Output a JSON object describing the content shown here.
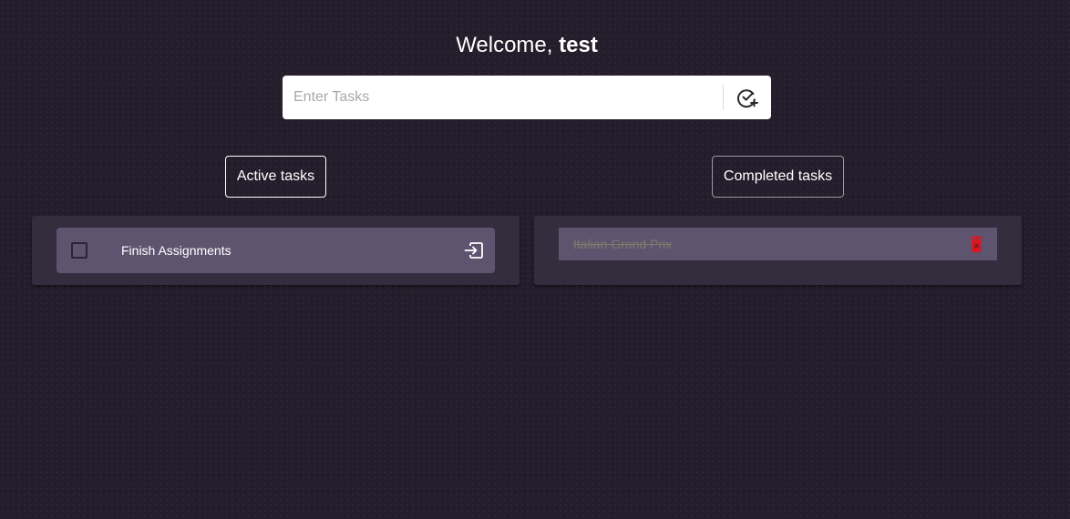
{
  "header": {
    "greeting": "Welcome,",
    "username": "test"
  },
  "task_input": {
    "placeholder": "Enter Tasks",
    "value": "",
    "add_icon": "check-circle-plus-icon"
  },
  "sections": {
    "active_label": "Active tasks",
    "completed_label": "Completed tasks"
  },
  "active_tasks": [
    {
      "label": "Finish Assignments",
      "checked": false,
      "action_icon": "move-to-completed-icon"
    }
  ],
  "completed_tasks": [
    {
      "label": "Italian Grand Prix",
      "action_icon": "delete-icon"
    }
  ],
  "colors": {
    "background": "#241d2b",
    "panel": "#342d3e",
    "item": "#5e5470",
    "delete": "#e0141e"
  }
}
